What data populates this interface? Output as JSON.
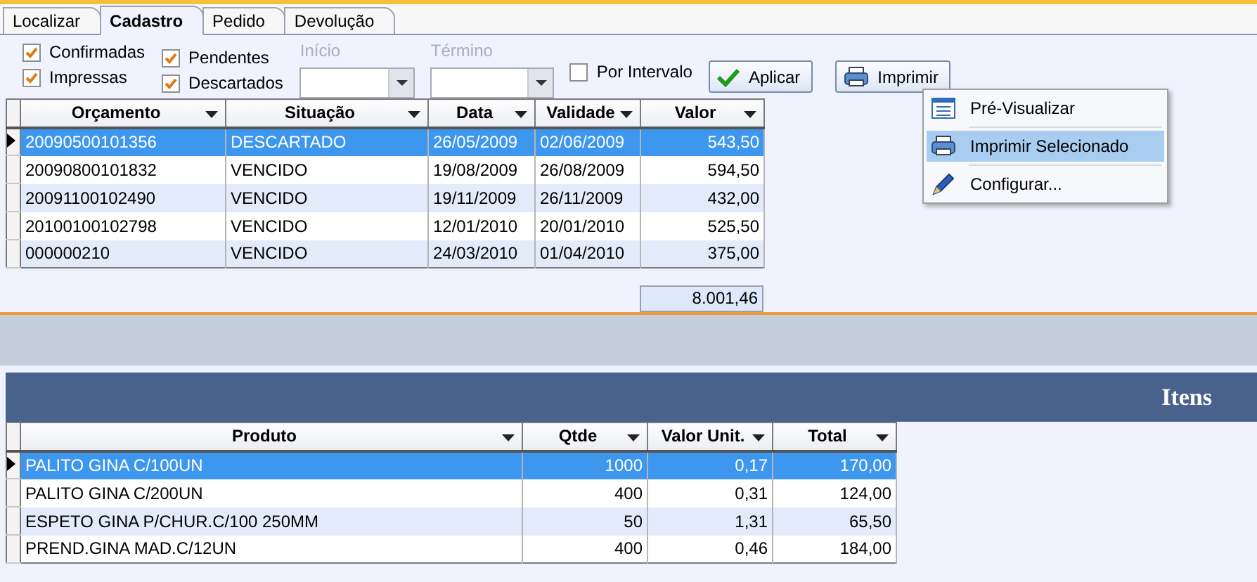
{
  "tabs": [
    {
      "label": "Localizar",
      "selected": false
    },
    {
      "label": "Cadastro",
      "selected": true
    },
    {
      "label": "Pedido",
      "selected": false
    },
    {
      "label": "Devolução",
      "selected": false
    }
  ],
  "filters": {
    "checkboxes": [
      {
        "label": "Confirmadas",
        "checked": true
      },
      {
        "label": "Impressas",
        "checked": true
      },
      {
        "label": "Pendentes",
        "checked": true
      },
      {
        "label": "Descartados",
        "checked": true
      }
    ],
    "start": {
      "label": "Início",
      "disabled": true
    },
    "end": {
      "label": "Término",
      "disabled": true
    },
    "interval": {
      "label": "Por Intervalo",
      "checked": false
    },
    "apply_button": "Aplicar",
    "print_button": "Imprimir"
  },
  "print_menu": [
    {
      "label": "Pré-Visualizar",
      "selected": false
    },
    {
      "label": "Imprimir Selecionado",
      "selected": true
    },
    {
      "label": "Configurar...",
      "selected": false
    }
  ],
  "budgets": {
    "columns": [
      "Orçamento",
      "Situação",
      "Data",
      "Validade",
      "Valor"
    ],
    "rows": [
      {
        "cells": [
          "20090500101356",
          "DESCARTADO",
          "26/05/2009",
          "02/06/2009",
          "543,50"
        ],
        "selected": true
      },
      {
        "cells": [
          "20090800101832",
          "VENCIDO",
          "19/08/2009",
          "26/08/2009",
          "594,50"
        ],
        "selected": false
      },
      {
        "cells": [
          "20091100102490",
          "VENCIDO",
          "19/11/2009",
          "26/11/2009",
          "432,00"
        ],
        "selected": false
      },
      {
        "cells": [
          "20100100102798",
          "VENCIDO",
          "12/01/2010",
          "20/01/2010",
          "525,50"
        ],
        "selected": false
      },
      {
        "cells": [
          "000000210",
          "VENCIDO",
          "24/03/2010",
          "01/04/2010",
          "375,00"
        ],
        "selected": false
      }
    ],
    "total": "8.001,46"
  },
  "items": {
    "title": "Itens",
    "columns": [
      "Produto",
      "Qtde",
      "Valor Unit.",
      "Total"
    ],
    "rows": [
      {
        "cells": [
          "PALITO GINA C/100UN",
          "1000",
          "0,17",
          "170,00"
        ],
        "selected": true
      },
      {
        "cells": [
          "PALITO GINA C/200UN",
          "400",
          "0,31",
          "124,00"
        ],
        "selected": false
      },
      {
        "cells": [
          "ESPETO GINA P/CHUR.C/100 250MM",
          "50",
          "1,31",
          "65,50"
        ],
        "selected": false
      },
      {
        "cells": [
          "PREND.GINA MAD.C/12UN",
          "400",
          "0,46",
          "184,00"
        ],
        "selected": false
      }
    ]
  }
}
